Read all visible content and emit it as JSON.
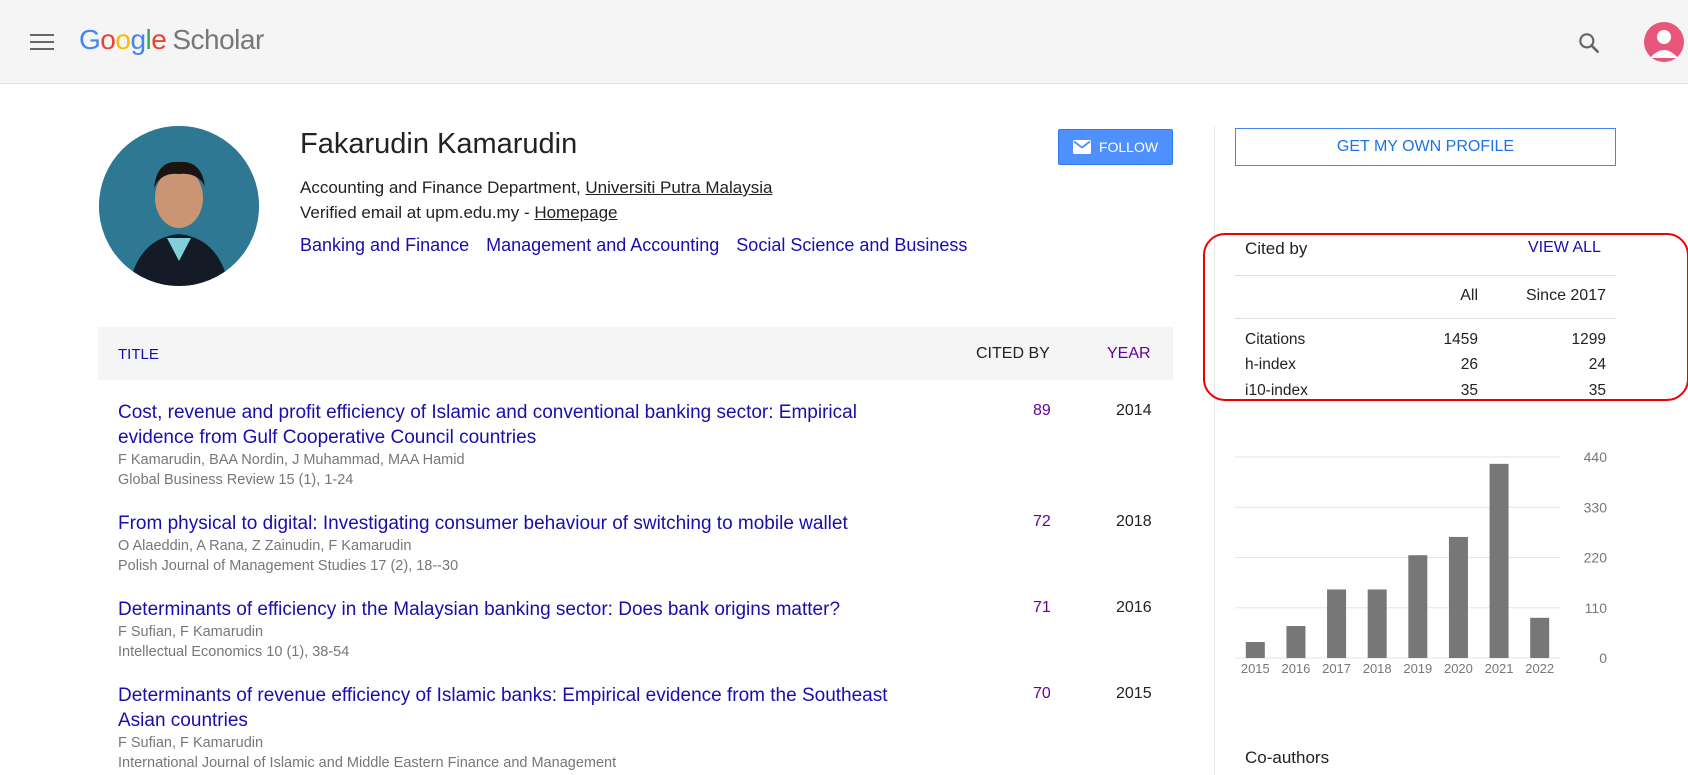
{
  "header": {
    "logo_google": "Google",
    "logo_scholar": "Scholar"
  },
  "profile": {
    "name": "Fakarudin Kamarudin",
    "affiliation_prefix": "Accounting and Finance Department, ",
    "affiliation_link": "Universiti Putra Malaysia",
    "verified_prefix": "Verified email at upm.edu.my - ",
    "homepage_link": "Homepage",
    "interests": [
      "Banking and Finance",
      "Management and Accounting",
      "Social Science and Business"
    ],
    "follow_label": "FOLLOW"
  },
  "table": {
    "headers": {
      "title": "TITLE",
      "cited_by": "CITED BY",
      "year": "YEAR"
    },
    "rows": [
      {
        "title": "Cost, revenue and profit efficiency of Islamic and conventional banking sector: Empirical evidence from Gulf Cooperative Council countries",
        "authors": "F Kamarudin, BAA Nordin, J Muhammad, MAA Hamid",
        "venue": "Global Business Review 15 (1), 1-24",
        "cited": "89",
        "year": "2014"
      },
      {
        "title": "From physical to digital: Investigating consumer behaviour of switching to mobile wallet",
        "authors": "O Alaeddin, A Rana, Z Zainudin, F Kamarudin",
        "venue": "Polish Journal of Management Studies 17 (2), 18--30",
        "cited": "72",
        "year": "2018"
      },
      {
        "title": "Determinants of efficiency in the Malaysian banking sector: Does bank origins matter?",
        "authors": "F Sufian, F Kamarudin",
        "venue": "Intellectual Economics 10 (1), 38-54",
        "cited": "71",
        "year": "2016"
      },
      {
        "title": "Determinants of revenue efficiency of Islamic banks: Empirical evidence from the Southeast Asian countries",
        "authors": "F Sufian, F Kamarudin",
        "venue": "International Journal of Islamic and Middle Eastern Finance and Management",
        "cited": "70",
        "year": "2015"
      }
    ]
  },
  "sidebar": {
    "own_profile_label": "GET MY OWN PROFILE",
    "cited_by_title": "Cited by",
    "view_all_label": "VIEW ALL",
    "col_all": "All",
    "col_since": "Since 2017",
    "stats": [
      {
        "label": "Citations",
        "all": "1459",
        "since": "1299"
      },
      {
        "label": "h-index",
        "all": "26",
        "since": "24"
      },
      {
        "label": "i10-index",
        "all": "35",
        "since": "35"
      }
    ],
    "coauthors_title": "Co-authors"
  },
  "colors": {
    "link": "#1a0dab",
    "visited": "#660099",
    "bar": "#777777",
    "highlight": "#ee0000"
  },
  "chart_data": {
    "type": "bar",
    "categories": [
      "2015",
      "2016",
      "2017",
      "2018",
      "2019",
      "2020",
      "2021",
      "2022"
    ],
    "values": [
      35,
      70,
      150,
      150,
      225,
      265,
      425,
      88
    ],
    "ylim": [
      0,
      440
    ],
    "yticks": [
      "0",
      "110",
      "220",
      "330",
      "440"
    ],
    "grid": true
  }
}
